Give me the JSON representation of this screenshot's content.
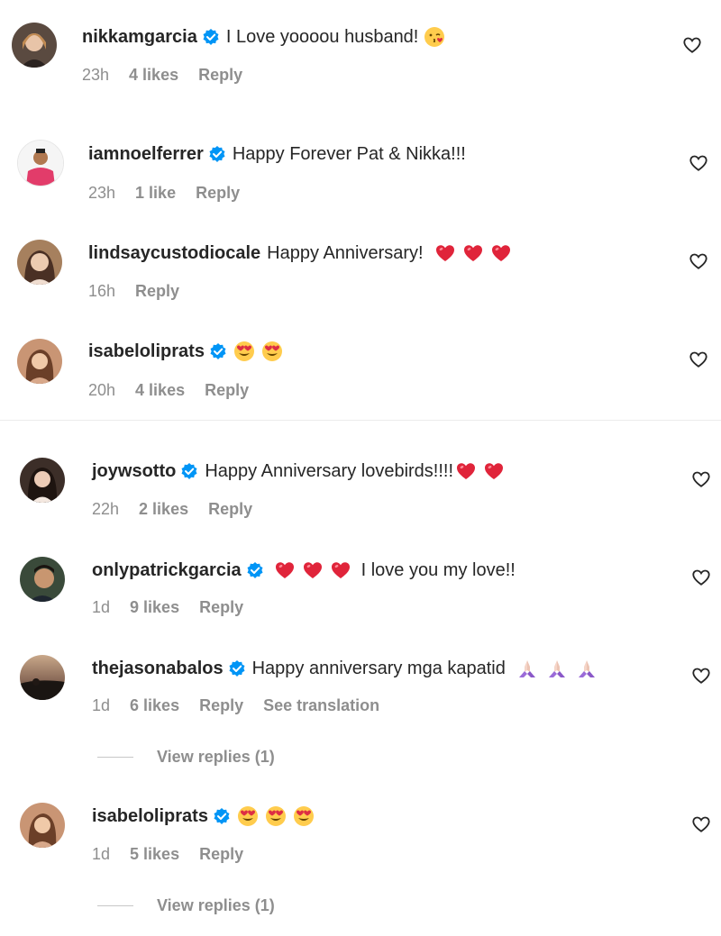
{
  "comments": [
    {
      "username": "nikkamgarcia",
      "verified": true,
      "text": "I Love yoooou husband!",
      "emojis": [
        "kiss-face"
      ],
      "time": "23h",
      "likes": "4 likes",
      "reply": "Reply",
      "translation": "",
      "avatar_color": "#5a4a40"
    },
    {
      "username": "iamnoelferrer",
      "verified": true,
      "text": "Happy Forever Pat & Nikka!!!",
      "emojis": [],
      "time": "23h",
      "likes": "1 like",
      "reply": "Reply",
      "translation": "",
      "avatar_color": "#e23c6a"
    },
    {
      "username": "lindsaycustodiocale",
      "verified": false,
      "text": "Happy Anniversary!",
      "emojis": [
        "red-heart",
        "red-heart",
        "red-heart"
      ],
      "time": "16h",
      "likes": "",
      "reply": "Reply",
      "translation": "",
      "avatar_color": "#a6805e"
    },
    {
      "username": "isabeloliprats",
      "verified": true,
      "text": "",
      "emojis": [
        "heart-eyes",
        "heart-eyes"
      ],
      "time": "20h",
      "likes": "4 likes",
      "reply": "Reply",
      "translation": "",
      "avatar_color": "#c99574"
    },
    {
      "username": "joywsotto",
      "verified": true,
      "text": "Happy Anniversary lovebirds!!!!",
      "emojis": [
        "red-heart",
        "red-heart"
      ],
      "time": "22h",
      "likes": "2 likes",
      "reply": "Reply",
      "translation": "",
      "avatar_color": "#3c2e28"
    },
    {
      "username": "onlypatrickgarcia",
      "verified": true,
      "text": "I love you my love!!",
      "emojis": [
        "red-heart",
        "red-heart",
        "red-heart"
      ],
      "time": "1d",
      "likes": "9 likes",
      "reply": "Reply",
      "translation": "",
      "avatar_color": "#3a4a3a"
    },
    {
      "username": "thejasonabalos",
      "verified": true,
      "text": "Happy anniversary mga kapatid",
      "emojis": [
        "praying-hands",
        "praying-hands",
        "praying-hands"
      ],
      "time": "1d",
      "likes": "6 likes",
      "reply": "Reply",
      "translation": "See translation",
      "avatar_color": "#2a2320"
    },
    {
      "username": "isabeloliprats",
      "verified": true,
      "text": "",
      "emojis": [
        "heart-eyes",
        "heart-eyes",
        "heart-eyes"
      ],
      "time": "1d",
      "likes": "5 likes",
      "reply": "Reply",
      "translation": "",
      "avatar_color": "#c99574"
    }
  ],
  "view_replies": [
    {
      "label": "View replies (1)"
    },
    {
      "label": "View replies (1)"
    }
  ],
  "icons": {
    "verified": "verified-badge-icon",
    "like": "heart-outline-icon"
  },
  "colors": {
    "verified_blue": "#0095f6",
    "muted_text": "#8e8e8e",
    "primary_text": "#262626"
  }
}
